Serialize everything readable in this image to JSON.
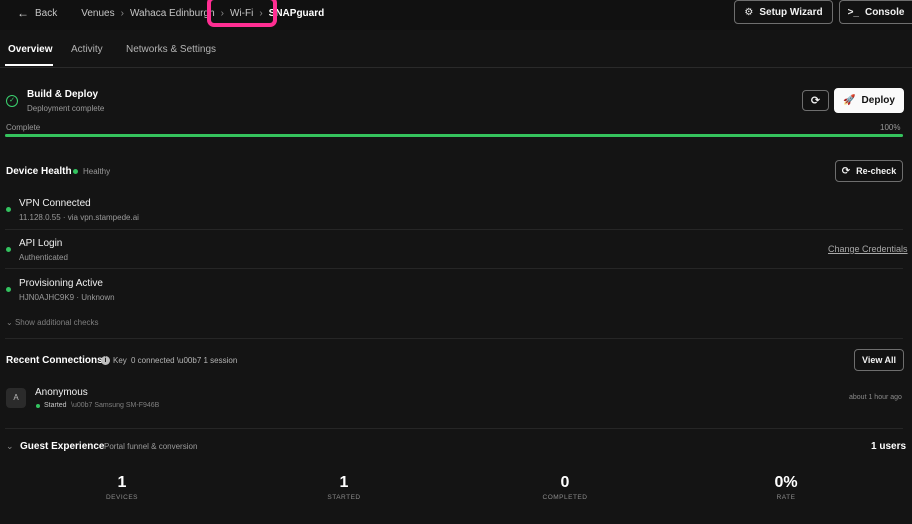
{
  "breadcrumb": {
    "back": "Back",
    "items": [
      "Venues",
      "Wahaca Edinburgh",
      "Wi-Fi"
    ],
    "current": "SNAPguard"
  },
  "header": {
    "setup_wizard": "Setup Wizard",
    "console": "Console"
  },
  "tabs": [
    "Overview",
    "Activity",
    "Networks & Settings"
  ],
  "build": {
    "title": "Build & Deploy",
    "subtitle": "Deployment complete",
    "deploy_label": "Deploy",
    "progress_label": "Complete",
    "progress_value": "100%",
    "progress_percent": 100
  },
  "health": {
    "title": "Device Health",
    "status": "Healthy",
    "recheck_label": "Re-check",
    "checks": [
      {
        "title": "VPN Connected",
        "subtitle": "11.128.0.55 · via vpn.stampede.ai"
      },
      {
        "title": "API Login",
        "subtitle": "Authenticated",
        "action": "Change Credentials"
      },
      {
        "title": "Provisioning Active",
        "subtitle": "HJN0AJHC9K9 · Unknown"
      }
    ],
    "show_more": "Show additional checks"
  },
  "connections": {
    "title": "Recent Connections",
    "key_label": "Key",
    "summary": "0 connected \\u00b7 1 session",
    "view_all": "View All",
    "rows": [
      {
        "avatar": "A",
        "name": "Anonymous",
        "status": "Started",
        "device": "\\u00b7 Samsung SM-F946B",
        "time": "about 1 hour ago"
      }
    ]
  },
  "guest": {
    "title": "Guest Experience",
    "subtitle": "Portal funnel & conversion",
    "users": "1 users",
    "stats": [
      {
        "value": "1",
        "label": "DEVICES"
      },
      {
        "value": "1",
        "label": "STARTED"
      },
      {
        "value": "0",
        "label": "COMPLETED"
      },
      {
        "value": "0%",
        "label": "RATE"
      }
    ]
  },
  "colors": {
    "accent_green": "#35c35d",
    "highlight_pink": "#ff2e92"
  }
}
